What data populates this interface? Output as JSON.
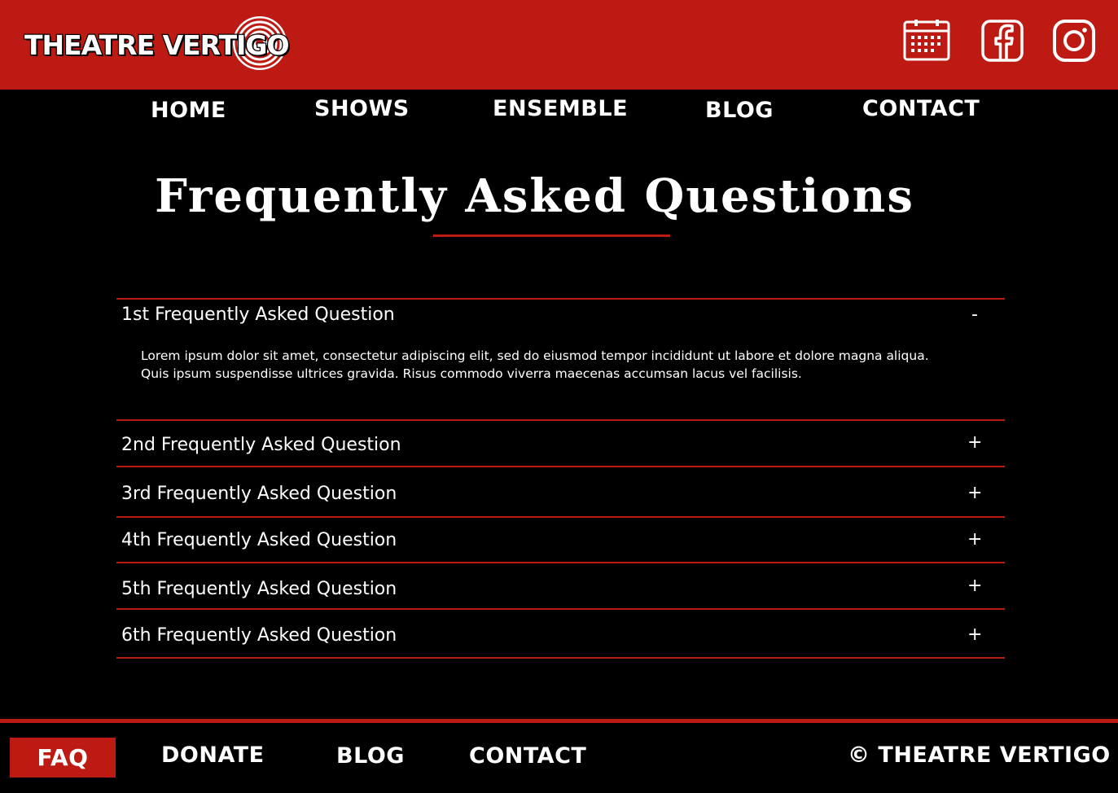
{
  "brand": {
    "logo_text": "THEATRE VERTIGO",
    "accent_color": "#BD1A13",
    "background_color": "#000000"
  },
  "header": {
    "icons": [
      "calendar-icon",
      "facebook-icon",
      "instagram-icon"
    ]
  },
  "nav": {
    "home": "HOME",
    "shows": "SHOWS",
    "ensemble": "ENSEMBLE",
    "blog": "BLOG",
    "contact": "CONTACT"
  },
  "page": {
    "title": "Frequently Asked Questions"
  },
  "faq": {
    "items": [
      {
        "question": "1st Frequently Asked Question",
        "toggle": "-",
        "expanded": true
      },
      {
        "question": "2nd Frequently Asked Question",
        "toggle": "+",
        "expanded": false
      },
      {
        "question": "3rd Frequently Asked Question",
        "toggle": "+",
        "expanded": false
      },
      {
        "question": "4th Frequently Asked Question",
        "toggle": "+",
        "expanded": false
      },
      {
        "question": "5th Frequently Asked Question",
        "toggle": "+",
        "expanded": false
      },
      {
        "question": "6th Frequently Asked Question",
        "toggle": "+",
        "expanded": false
      }
    ],
    "answer_line1": "Lorem ipsum dolor sit amet, consectetur adipiscing elit, sed do eiusmod tempor incididunt ut labore et dolore magna aliqua.",
    "answer_line2": "Quis ipsum suspendisse ultrices gravida. Risus commodo viverra maecenas accumsan lacus vel facilisis."
  },
  "footer": {
    "faq": "FAQ",
    "donate": "DONATE",
    "blog": "BLOG",
    "contact": "CONTACT",
    "copyright": "© THEATRE VERTIGO"
  }
}
